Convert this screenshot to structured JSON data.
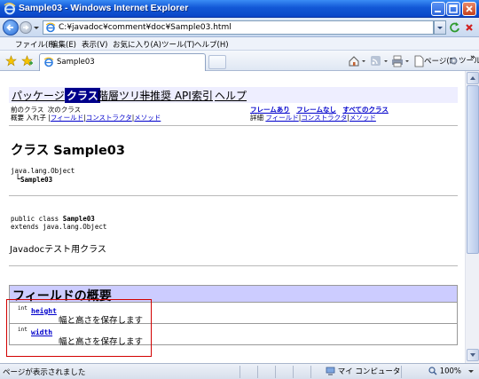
{
  "window": {
    "title": "Sample03 - Windows Internet Explorer"
  },
  "address": {
    "url": "C:¥javadoc¥comment¥doc¥Sample03.html"
  },
  "menu": [
    "ファイル(F)",
    "編集(E)",
    "表示(V)",
    "お気に入り(A)",
    "ツール(T)",
    "ヘルプ(H)"
  ],
  "tab": {
    "label": "Sample03"
  },
  "commands": {
    "page": "ページ(P)",
    "tools": "ツール(O)",
    "more": "»"
  },
  "navbar": {
    "package": "パッケージ",
    "class": "クラス",
    "tree": "階層ツリー",
    "deprecated": "非推奨 API",
    "index": "索引",
    "help": "ヘルプ"
  },
  "subnav": {
    "prev_class": "前のクラス",
    "next_class": "次のクラス",
    "frames": "フレームあり",
    "no_frames": "フレームなし",
    "all_classes": "すべてのクラス",
    "summary_label": "概要",
    "summary_nested": "入れ子",
    "summary_field": "フィールド",
    "summary_constructor": "コンストラクタ",
    "summary_method": "メソッド",
    "detail_label": "詳細",
    "detail_field": "フィールド",
    "detail_constructor": "コンストラクタ",
    "detail_method": "メソッド",
    "separator": "|"
  },
  "class_page": {
    "title": "クラス Sample03",
    "hierarchy_parent": "java.lang.Object",
    "hierarchy_child": "Sample03",
    "hierarchy_branch": "└",
    "decl_prefix": "public class ",
    "decl_name": "Sample03",
    "decl_extends": "extends java.lang.Object",
    "description": "Javadocテスト用クラス"
  },
  "field_summary": {
    "heading": "フィールドの概要",
    "fields": [
      {
        "type": "int",
        "name": "height",
        "description": "幅と高さを保存します"
      },
      {
        "type": "int",
        "name": "width",
        "description": "幅と高さを保存します"
      }
    ]
  },
  "status": {
    "text": "ページが表示されました",
    "zone": "マイ コンピュータ",
    "zoom": "100%"
  },
  "colors": {
    "navbar_bg": "#eeeeff",
    "nav_current_bg": "#00008b",
    "table_head_bg": "#ccccff",
    "link": "#0000cc",
    "highlight_border": "#d20000"
  }
}
